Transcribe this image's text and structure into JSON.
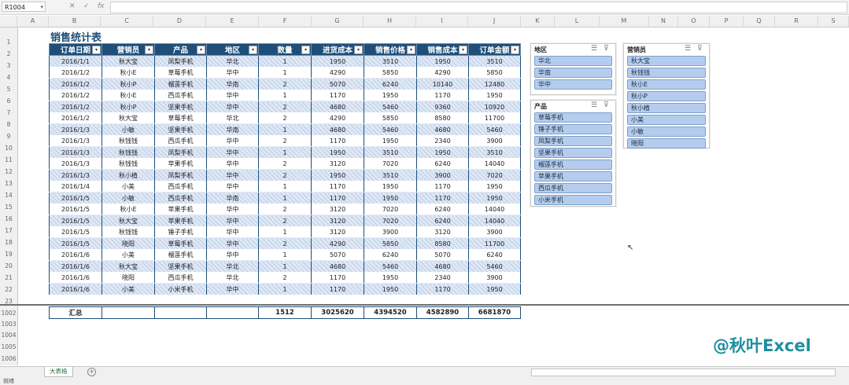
{
  "formula_bar": {
    "name_box": "R1004",
    "fx_label": "fx"
  },
  "columns": [
    "A",
    "B",
    "C",
    "D",
    "E",
    "F",
    "G",
    "H",
    "I",
    "J",
    "K",
    "L",
    "M",
    "N",
    "O",
    "P",
    "Q",
    "R",
    "S"
  ],
  "row_numbers": [
    "1",
    "2",
    "3",
    "4",
    "5",
    "6",
    "7",
    "8",
    "9",
    "10",
    "11",
    "12",
    "13",
    "14",
    "15",
    "16",
    "17",
    "18",
    "19",
    "20",
    "21",
    "22",
    "23",
    "1002",
    "1003",
    "1004",
    "1005",
    "1006"
  ],
  "title": "销售统计表",
  "table": {
    "headers": [
      "订单日期",
      "营销员",
      "产品",
      "地区",
      "数量",
      "进货成本",
      "销售价格",
      "销售成本",
      "订单金额"
    ],
    "rows": [
      [
        "2016/1/1",
        "秋大宝",
        "凤梨手机",
        "华北",
        "1",
        "1950",
        "3510",
        "1950",
        "3510"
      ],
      [
        "2016/1/2",
        "秋小E",
        "草莓手机",
        "华中",
        "1",
        "4290",
        "5850",
        "4290",
        "5850"
      ],
      [
        "2016/1/2",
        "秋小P",
        "榴莲手机",
        "华南",
        "2",
        "5070",
        "6240",
        "10140",
        "12480"
      ],
      [
        "2016/1/2",
        "秋小E",
        "西瓜手机",
        "华中",
        "1",
        "1170",
        "1950",
        "1170",
        "1950"
      ],
      [
        "2016/1/2",
        "秋小P",
        "坚果手机",
        "华中",
        "2",
        "4680",
        "5460",
        "9360",
        "10920"
      ],
      [
        "2016/1/2",
        "秋大宝",
        "草莓手机",
        "华北",
        "2",
        "4290",
        "5850",
        "8580",
        "11700"
      ],
      [
        "2016/1/3",
        "小敏",
        "坚果手机",
        "华南",
        "1",
        "4680",
        "5460",
        "4680",
        "5460"
      ],
      [
        "2016/1/3",
        "秋钱钱",
        "西瓜手机",
        "华中",
        "2",
        "1170",
        "1950",
        "2340",
        "3900"
      ],
      [
        "2016/1/3",
        "秋钱钱",
        "凤梨手机",
        "华中",
        "1",
        "1950",
        "3510",
        "1950",
        "3510"
      ],
      [
        "2016/1/3",
        "秋钱钱",
        "苹果手机",
        "华中",
        "2",
        "3120",
        "7020",
        "6240",
        "14040"
      ],
      [
        "2016/1/3",
        "秋小植",
        "凤梨手机",
        "华中",
        "2",
        "1950",
        "3510",
        "3900",
        "7020"
      ],
      [
        "2016/1/4",
        "小美",
        "西瓜手机",
        "华中",
        "1",
        "1170",
        "1950",
        "1170",
        "1950"
      ],
      [
        "2016/1/5",
        "小敏",
        "西瓜手机",
        "华南",
        "1",
        "1170",
        "1950",
        "1170",
        "1950"
      ],
      [
        "2016/1/5",
        "秋小E",
        "苹果手机",
        "华中",
        "2",
        "3120",
        "7020",
        "6240",
        "14040"
      ],
      [
        "2016/1/5",
        "秋大宝",
        "苹果手机",
        "华中",
        "2",
        "3120",
        "7020",
        "6240",
        "14040"
      ],
      [
        "2016/1/5",
        "秋钱钱",
        "锤子手机",
        "华中",
        "1",
        "3120",
        "3900",
        "3120",
        "3900"
      ],
      [
        "2016/1/5",
        "晓阳",
        "草莓手机",
        "华中",
        "2",
        "4290",
        "5850",
        "8580",
        "11700"
      ],
      [
        "2016/1/6",
        "小美",
        "榴莲手机",
        "华中",
        "1",
        "5070",
        "6240",
        "5070",
        "6240"
      ],
      [
        "2016/1/6",
        "秋大宝",
        "坚果手机",
        "华北",
        "1",
        "4680",
        "5460",
        "4680",
        "5460"
      ],
      [
        "2016/1/6",
        "晓阳",
        "西瓜手机",
        "华北",
        "2",
        "1170",
        "1950",
        "2340",
        "3900"
      ],
      [
        "2016/1/6",
        "小美",
        "小米手机",
        "华中",
        "1",
        "1170",
        "1950",
        "1170",
        "1950"
      ]
    ],
    "total": {
      "label": "汇总",
      "quantity": "1512",
      "cost": "3025620",
      "price": "4394520",
      "sales_cost": "4582890",
      "amount": "6681870"
    }
  },
  "slicers": {
    "region": {
      "title": "地区",
      "items": [
        "华北",
        "华南",
        "华中"
      ]
    },
    "product": {
      "title": "产品",
      "items": [
        "草莓手机",
        "锤子手机",
        "凤梨手机",
        "坚果手机",
        "榴莲手机",
        "苹果手机",
        "西瓜手机",
        "小米手机"
      ]
    },
    "salesperson": {
      "title": "营销员",
      "items": [
        "秋大宝",
        "秋钱钱",
        "秋小E",
        "秋小P",
        "秋小植",
        "小美",
        "小敏",
        "晓阳"
      ]
    }
  },
  "watermark": "@秋叶Excel",
  "sheet_tab": "大表格",
  "status": {
    "mode": "就绪"
  },
  "colors": {
    "header_bg": "#1f4e79",
    "slicer_item": "#b4cdee",
    "watermark": "#1e8fa0"
  }
}
